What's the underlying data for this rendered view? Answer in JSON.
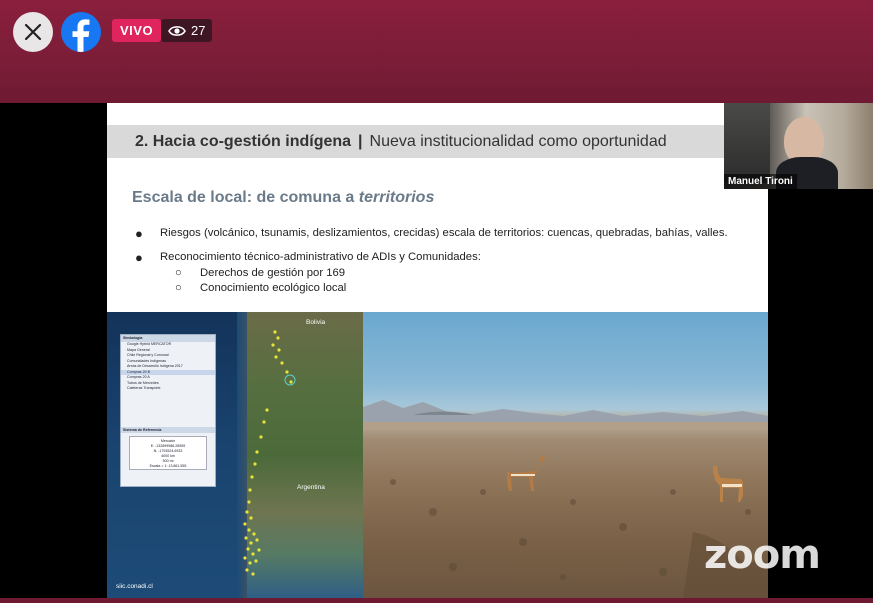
{
  "live_bar": {
    "live_label": "VIVO",
    "viewer_count": "27",
    "brand_color": "#1877f2",
    "live_color": "#e0245e"
  },
  "slide": {
    "header_bold": "2. Hacia co-gestión indígena",
    "header_separator": "|",
    "header_rest": "Nueva institucionalidad como oportunidad",
    "subtitle_plain": "Escala de local: de comuna a ",
    "subtitle_italic": "territorios",
    "bullet_1": "Riesgos (volcánico, tsunamis, deslizamientos, crecidas) escala de territorios: cuencas, quebradas, bahías, valles.",
    "bullet_2": "Reconocimiento técnico-administrativo de ADIs y Comunidades:",
    "sub_bullets": [
      "Derechos de gestión por 169",
      "Conocimiento ecológico local"
    ]
  },
  "map": {
    "label_bolivia": "Bolivia",
    "label_argentina": "Argentina",
    "source": "siic.conadi.cl",
    "panel_title": "Simbología",
    "panel_select": "Google Hybrid MERCATOR",
    "layers": [
      "Mapa General",
      "Chile Regional y Comunal",
      "Comunidades Indígenas",
      "Áreas de Desarrollo Indígena 2017",
      "Compras 20 B",
      "Compras 20 A",
      "Tubos de Mercedes",
      "Caleteras Transporte"
    ],
    "ref_title": "Sistema de Referencia",
    "ref_lines": [
      "Mercator",
      "E: -132899986.28959",
      "N: -1793524.6933",
      "4000 km",
      "500 mi",
      "Escala = 1: 13.861.555"
    ]
  },
  "webcam": {
    "participant_name": "Manuel Tironi"
  },
  "watermark": "zoom"
}
